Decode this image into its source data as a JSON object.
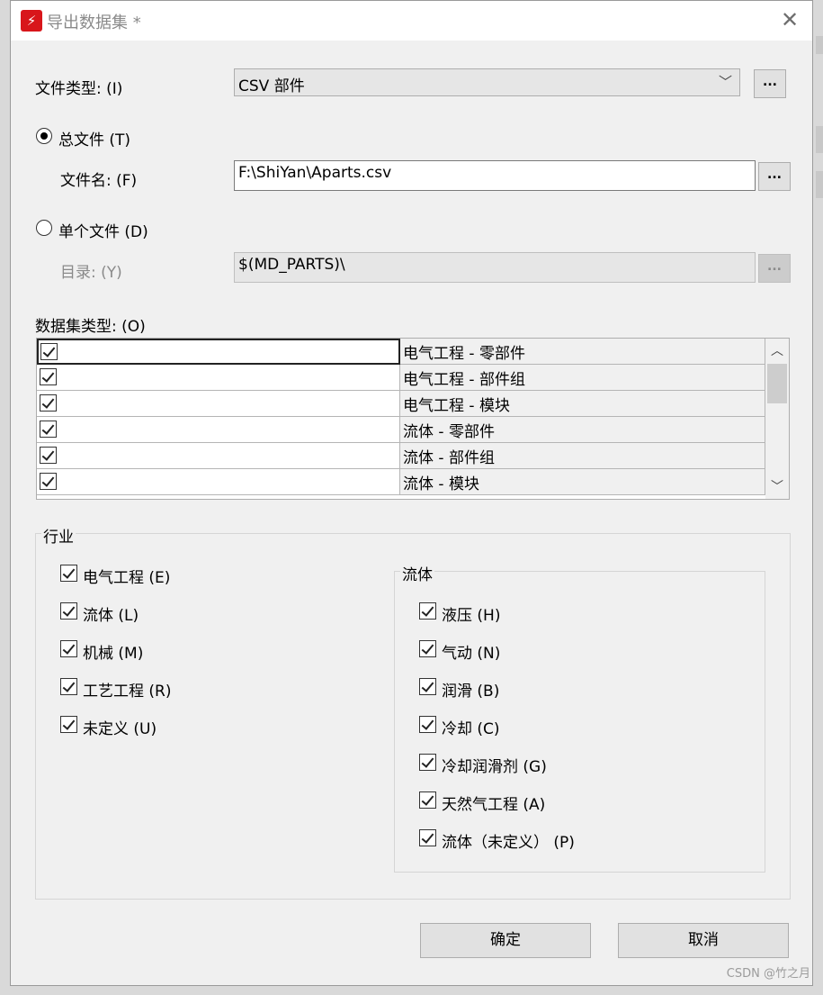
{
  "window": {
    "title": "导出数据集 *"
  },
  "file_type": {
    "label": "文件类型: (I)",
    "value": "CSV 部件",
    "more_label": "..."
  },
  "total_file": {
    "label": "总文件 (T)",
    "selected": true,
    "filename_label": "文件名: (F)",
    "filename_value": "F:\\ShiYan\\Aparts.csv",
    "browse_label": "..."
  },
  "single_file": {
    "label": "单个文件 (D)",
    "selected": false,
    "directory_label": "目录: (Y)",
    "directory_value": "$(MD_PARTS)\\",
    "browse_label": "..."
  },
  "dataset_types": {
    "label": "数据集类型: (O)",
    "rows": [
      {
        "checked": true,
        "name": "电气工程 - 零部件"
      },
      {
        "checked": true,
        "name": "电气工程 - 部件组"
      },
      {
        "checked": true,
        "name": "电气工程 - 模块"
      },
      {
        "checked": true,
        "name": "流体 - 零部件"
      },
      {
        "checked": true,
        "name": "流体 - 部件组"
      },
      {
        "checked": true,
        "name": "流体 - 模块"
      }
    ]
  },
  "industry": {
    "label": "行业",
    "items": [
      {
        "label": "电气工程 (E)",
        "checked": true
      },
      {
        "label": "流体 (L)",
        "checked": true
      },
      {
        "label": "机械 (M)",
        "checked": true
      },
      {
        "label": "工艺工程 (R)",
        "checked": true
      },
      {
        "label": "未定义 (U)",
        "checked": true
      }
    ],
    "fluid": {
      "label": "流体",
      "items": [
        {
          "label": "液压 (H)",
          "checked": true
        },
        {
          "label": "气动 (N)",
          "checked": true
        },
        {
          "label": "润滑 (B)",
          "checked": true
        },
        {
          "label": "冷却 (C)",
          "checked": true
        },
        {
          "label": "冷却润滑剂 (G)",
          "checked": true
        },
        {
          "label": "天然气工程 (A)",
          "checked": true
        },
        {
          "label": "流体（未定义） (P)",
          "checked": true
        }
      ]
    }
  },
  "buttons": {
    "ok": "确定",
    "cancel": "取消"
  },
  "watermark": "CSDN @竹之月"
}
